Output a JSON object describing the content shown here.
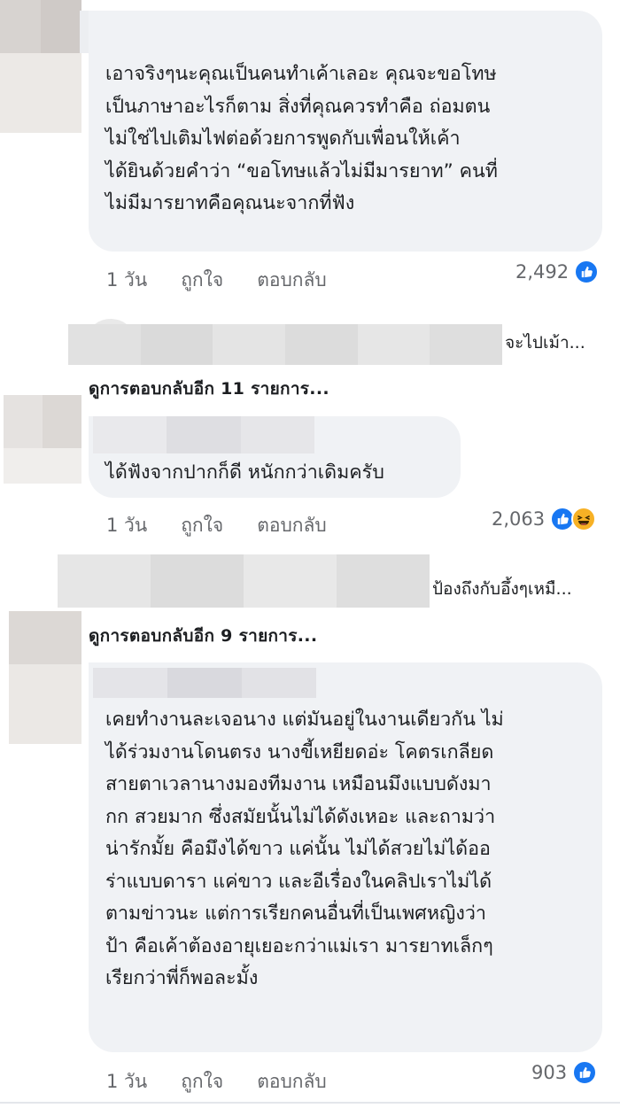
{
  "comments": [
    {
      "lines": [
        "เอาจริงๆนะคุณเป็นคนทำเค้าเลอะ คุณจะขอโทษ",
        "เป็นภาษาอะไรก็ตาม สิ่งที่คุณควรทำคือ ถ่อมตน",
        "ไม่ใช่ไปเติมไฟต่อด้วยการพูดกับเพื่อนให้เค้า",
        "ได้ยินด้วยคำว่า “ขอโทษแล้วไม่มีมารยาท” คนที่",
        "ไม่มีมารยาทคือคุณนะจากที่ฟัง"
      ],
      "time": "1 วัน",
      "like": "ถูกใจ",
      "reply": "ตอบกลับ",
      "reaction_count": "2,492",
      "reaction_icons": [
        "like-icon"
      ]
    },
    {
      "lines": [
        "ได้ฟังจากปากก็ดี หนักกว่าเดิมครับ"
      ],
      "time": "1 วัน",
      "like": "ถูกใจ",
      "reply": "ตอบกลับ",
      "reaction_count": "2,063",
      "reaction_icons": [
        "like-icon",
        "haha-icon"
      ]
    },
    {
      "lines": [
        "เคยทำงานละเจอนาง แต่มันอยู่ในงานเดียวกัน ไม่",
        "ได้ร่วมงานโดนตรง นางขี้เหยียดอ่ะ โคตรเกลียด",
        "สายตาเวลานางมองทีมงาน เหมือนมึงแบบดังมา",
        "กก สวยมาก ซึ่งสมัยนั้นไม่ได้ดังเหอะ และถามว่า",
        "น่ารักมั้ย คือมึงได้ขาว แค่นั้น ไม่ได้สวยไม่ได้ออ",
        "ร่าแบบดารา แค่ขาว และอีเรื่องในคลิปเราไม่ได้",
        "ตามข่าวนะ แต่การเรียกคนอื่นที่เป็นเพศหญิงว่า",
        "ป้า คือเค้าต้องอายุเยอะกว่าแม่เรา มารยาทเล็กๆ",
        "เรียกว่าพี่ก็พอละมั้ง"
      ],
      "time": "1 วัน",
      "like": "ถูกใจ",
      "reply": "ตอบกลับ",
      "reaction_count": "903",
      "reaction_icons": [
        "like-icon"
      ]
    }
  ],
  "reply_previews": [
    {
      "snippet": "จะไปเม้า..."
    },
    {
      "snippet": "ป้องถึงกับอึ้งๆเหมื..."
    }
  ],
  "view_more": [
    "ดูการตอบกลับอีก 11 รายการ...",
    "ดูการตอบกลับอีก 9 รายการ..."
  ],
  "colors": {
    "bubble": "#f0f2f5",
    "like_blue": "#1877f2",
    "haha_yellow": "#f7b125",
    "meta_gray": "#65676b"
  }
}
